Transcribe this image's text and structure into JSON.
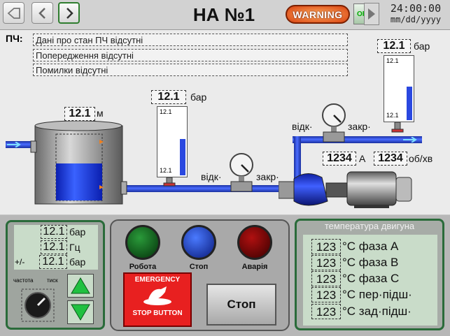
{
  "header": {
    "title": "НА №1",
    "warning_label": "WARNING",
    "off_label": "OFF",
    "clock_time": "24:00:00",
    "clock_date": "mm/dd/yyyy"
  },
  "info": {
    "label": "ПЧ:",
    "lines": [
      "Дані про стан ПЧ відсутні",
      "Попередження відсутні",
      "Помилки відсутні"
    ]
  },
  "tank": {
    "level_value": "12.1",
    "level_unit": "м"
  },
  "gauge_left": {
    "value": "12.1",
    "unit": "бар",
    "top_scale": "12.1",
    "bottom_scale": "12.1"
  },
  "gauge_right": {
    "value": "12.1",
    "unit": "бар",
    "top_scale": "12.1",
    "bottom_scale": "12.1"
  },
  "valves": {
    "left_open": "відк·",
    "left_closed": "закр·",
    "right_open": "відк·",
    "right_closed": "закр·"
  },
  "motor": {
    "current_value": "1234",
    "current_unit": "А",
    "speed_value": "1234",
    "speed_unit": "об/хв"
  },
  "control_panel": {
    "pressure_value": "12.1",
    "pressure_unit": "бар",
    "freq_value": "12.1",
    "freq_unit": "Гц",
    "delta_label": "+/-",
    "delta_value": "12.1",
    "delta_unit": "бар",
    "knob_label_left": "частота",
    "knob_label_right": "тиск"
  },
  "lamps": {
    "run": "Робота",
    "stop": "Стоп",
    "alarm": "Аварія"
  },
  "emergency": {
    "line1": "EMERGENCY",
    "line2": "STOP BUTTON"
  },
  "stop_button": "Стоп",
  "temperature": {
    "title": "температура двигуна",
    "rows": [
      {
        "value": "123",
        "label": "°С фаза А"
      },
      {
        "value": "123",
        "label": "°С фаза В"
      },
      {
        "value": "123",
        "label": "°С фаза С"
      },
      {
        "value": "123",
        "label": "°С пер·підш·"
      },
      {
        "value": "123",
        "label": "°С зад·підш·"
      }
    ]
  },
  "colors": {
    "accent_green": "#2a6b3a",
    "pipe_blue": "#2a48e0",
    "warning_orange": "#e05010"
  }
}
